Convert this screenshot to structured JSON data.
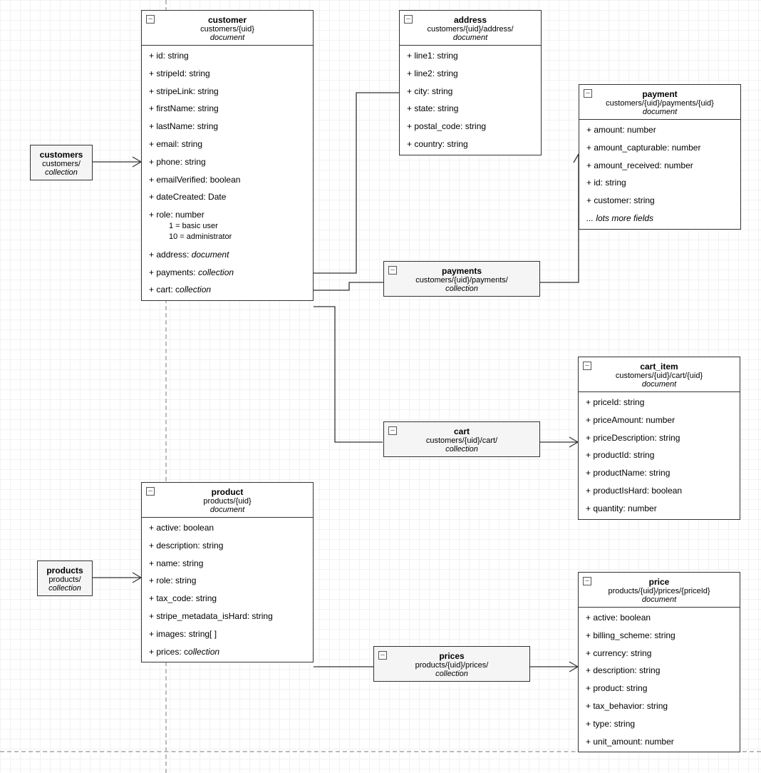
{
  "customers": {
    "title": "customers",
    "path": "customers/",
    "stype": "collection"
  },
  "customer": {
    "title": "customer",
    "path": "customers/{uid}",
    "stype": "document",
    "fields": [
      "+ id: string",
      "+ stripeId: string",
      "+ stripeLink: string",
      "+ firstName: string",
      "+ lastName: string",
      "+ email: string",
      "+ phone: string",
      "+ emailVerified: boolean",
      "+ dateCreated: Date"
    ],
    "role_field": "+ role: number",
    "role_sub1": "1 = basic user",
    "role_sub2": "10 = administrator",
    "address_field_pre": "+ address: ",
    "address_field_em": "document",
    "payments_field_pre": "+ payments: ",
    "payments_field_em": "collection",
    "cart_field_pre": "+ cart: c",
    "cart_field_em": "ollection"
  },
  "address": {
    "title": "address",
    "path": "customers/{uid}/address/",
    "stype": "document",
    "fields": [
      "+ line1: string",
      "+ line2: string",
      "+ city: string",
      "+ state: string",
      "+ postal_code: string",
      "+ country: string"
    ]
  },
  "payments": {
    "title": "payments",
    "path": "customers/{uid}/payments/",
    "stype": "collection"
  },
  "payment": {
    "title": "payment",
    "path": "customers/{uid}/payments/{uid}",
    "stype": "document",
    "fields": [
      "+ amount: number",
      "+ amount_capturable: number",
      "+ amount_received: number",
      "+ id: string",
      "+ customer: string"
    ],
    "more_em": "... lots more fields"
  },
  "cart": {
    "title": "cart",
    "path": "customers/{uid}/cart/",
    "stype": "collection"
  },
  "cart_item": {
    "title": "cart_item",
    "path": "customers/{uid}/cart/{uid}",
    "stype": "document",
    "fields": [
      "+ priceId: string",
      "+ priceAmount: number",
      "+ priceDescription: string",
      "+ productId: string",
      "+ productName: string",
      "+ productIsHard: boolean",
      "+ quantity: number"
    ]
  },
  "products": {
    "title": "products",
    "path": "products/",
    "stype": "collection"
  },
  "product": {
    "title": "product",
    "path": "products/{uid}",
    "stype": "document",
    "fields": [
      "+ active: boolean",
      "+ description: string",
      "+ name: string",
      "+ role: string",
      "+ tax_code: string",
      "+ stripe_metadata_isHard: string",
      "+ images: string[ ]"
    ],
    "prices_field_pre": "+ prices: c",
    "prices_field_em": "ollection"
  },
  "prices": {
    "title": "prices",
    "path": "products/{uid}/prices/",
    "stype": "collection"
  },
  "price": {
    "title": "price",
    "path": "products/{uid}/prices/{priceId}",
    "stype": "document",
    "fields": [
      "+ active: boolean",
      "+ billing_scheme: string",
      "+ currency: string",
      "+ description: string",
      "+ product: string",
      "+ tax_behavior: string",
      "+ type: string",
      "+ unit_amount: number"
    ]
  }
}
